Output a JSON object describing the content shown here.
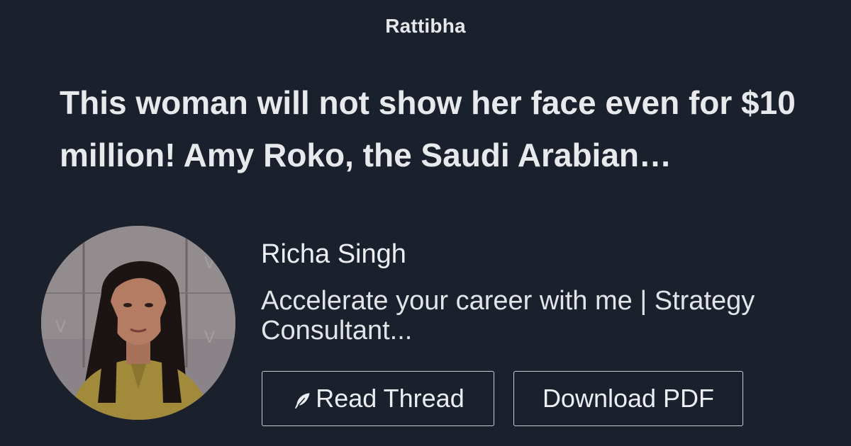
{
  "site": {
    "brand": "Rattibha"
  },
  "thread": {
    "title": "This woman will not show her face even for $10 million! Amy Roko, the Saudi Arabian…"
  },
  "author": {
    "name": "Richa Singh",
    "bio": "Accelerate your career with me | Strategy Consultant..."
  },
  "actions": {
    "read_label": "Read Thread",
    "read_icon": "feather-icon",
    "download_label": "Download PDF"
  },
  "colors": {
    "background": "#1a202c",
    "text": "#e2e4e8",
    "button_border": "#c9ccd1"
  }
}
